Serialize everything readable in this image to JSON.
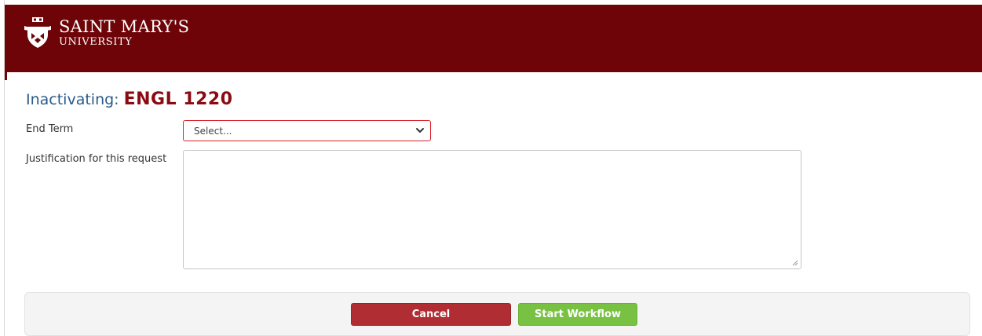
{
  "header": {
    "logo_main": "SAINT MARY'S",
    "logo_sub": "UNIVERSITY",
    "background_color": "#6e0408"
  },
  "title": {
    "prefix": "Inactivating:",
    "course": "ENGL 1220",
    "prefix_color": "#2a5a8a",
    "course_color": "#8b0b12"
  },
  "form": {
    "end_term_label": "End Term",
    "end_term_value": "Select...",
    "end_term_icon": "chevron-down-icon",
    "justification_label": "Justification for this request",
    "justification_value": ""
  },
  "actions": {
    "cancel_label": "Cancel",
    "start_label": "Start Workflow",
    "cancel_color": "#b02d34",
    "start_color": "#79c142"
  }
}
